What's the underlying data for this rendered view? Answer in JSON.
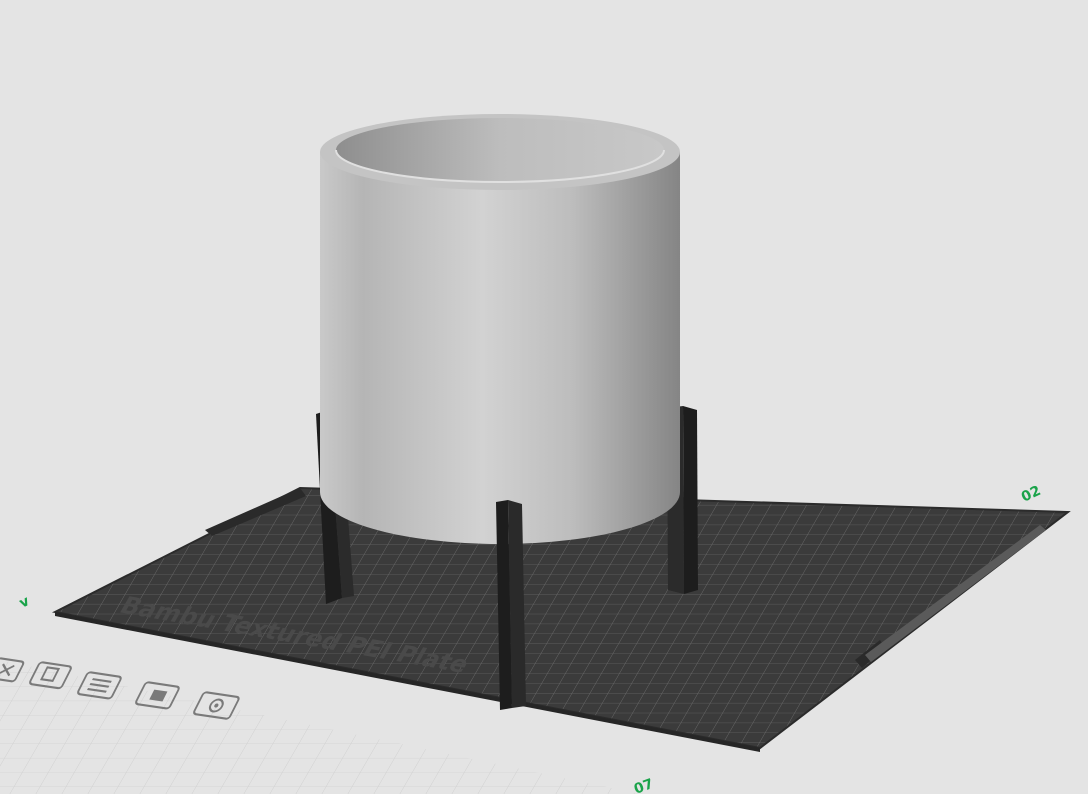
{
  "scene": {
    "plate_name": "Bambu Textured PEI Plate",
    "plate_index": "02",
    "plate_axis_label_left": "v",
    "plate_axis_label_bottom": "07",
    "colors": {
      "background": "#e4e4e4",
      "plate_surface": "#3a3a3a",
      "plate_grid": "#6a6a6a",
      "cylinder_light": "#d8d8d8",
      "cylinder_dark": "#8a8a8a",
      "legs": "#1f1f1f",
      "axis_green": "#1aa34a"
    }
  },
  "plate_toolbar": {
    "icons": [
      {
        "name": "close-plate-icon",
        "label": ""
      },
      {
        "name": "auto-orient-icon",
        "label": ""
      },
      {
        "name": "arrange-icon",
        "label": ""
      },
      {
        "name": "lock-icon",
        "label": ""
      },
      {
        "name": "plate-settings-icon",
        "label": ""
      }
    ]
  }
}
